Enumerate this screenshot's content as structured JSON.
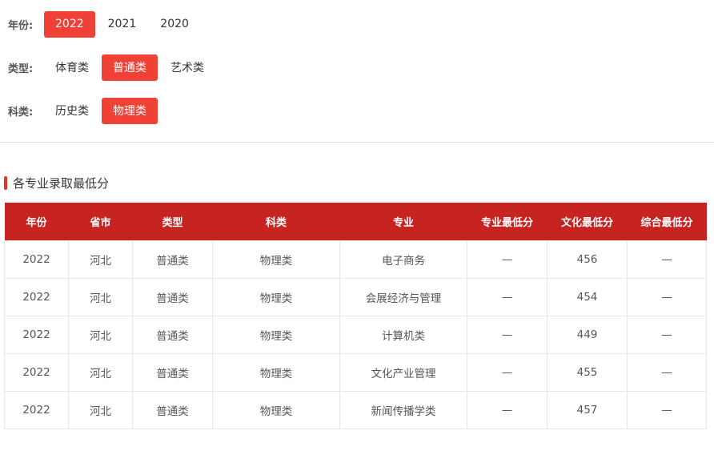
{
  "filters": {
    "year": {
      "label": "年份:",
      "options": [
        "2022",
        "2021",
        "2020"
      ],
      "active": 0
    },
    "type": {
      "label": "类型:",
      "options": [
        "体育类",
        "普通类",
        "艺术类"
      ],
      "active": 1
    },
    "subject": {
      "label": "科类:",
      "options": [
        "历史类",
        "物理类"
      ],
      "active": 1
    }
  },
  "section": {
    "title": "各专业录取最低分"
  },
  "table": {
    "headers": [
      "年份",
      "省市",
      "类型",
      "科类",
      "专业",
      "专业最低分",
      "文化最低分",
      "综合最低分"
    ],
    "rows": [
      [
        "2022",
        "河北",
        "普通类",
        "物理类",
        "电子商务",
        "—",
        "456",
        "—"
      ],
      [
        "2022",
        "河北",
        "普通类",
        "物理类",
        "会展经济与管理",
        "—",
        "454",
        "—"
      ],
      [
        "2022",
        "河北",
        "普通类",
        "物理类",
        "计算机类",
        "—",
        "449",
        "—"
      ],
      [
        "2022",
        "河北",
        "普通类",
        "物理类",
        "文化产业管理",
        "—",
        "455",
        "—"
      ],
      [
        "2022",
        "河北",
        "普通类",
        "物理类",
        "新闻传播学类",
        "—",
        "457",
        "—"
      ]
    ]
  },
  "colors": {
    "accent": "#f04137",
    "header_bg": "#c62321",
    "title_bar": "#e8332c"
  }
}
